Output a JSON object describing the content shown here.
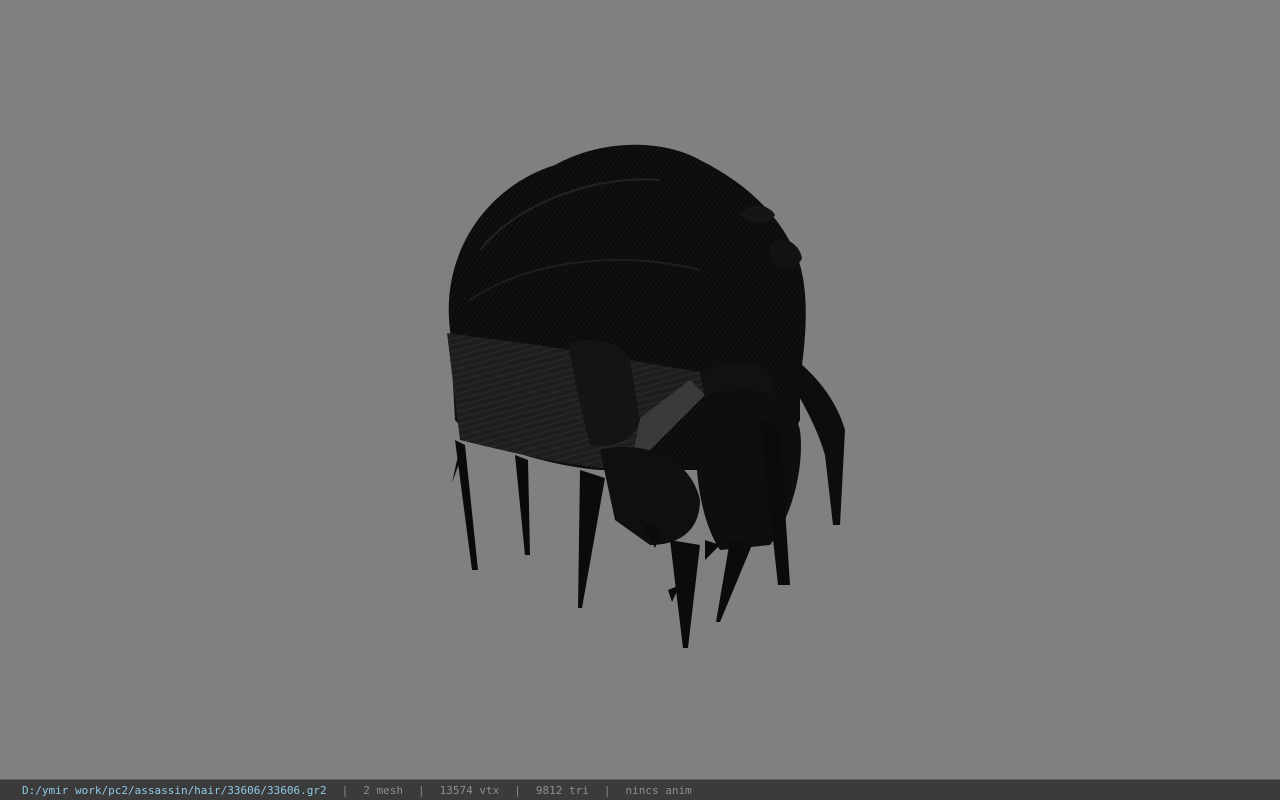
{
  "viewer": {
    "background_color": "#808080",
    "model_color": "#0b0b0b"
  },
  "status_bar": {
    "file_path": "D:/ymir work/pc2/assassin/hair/33606/33606.gr2",
    "separator": "|",
    "mesh_count": "2 mesh",
    "vertex_count": "13574 vtx",
    "triangle_count": "9812 tri",
    "anim_status": "nincs anim",
    "path_color": "#8fc8e6",
    "background_color": "#3b3b3b"
  }
}
